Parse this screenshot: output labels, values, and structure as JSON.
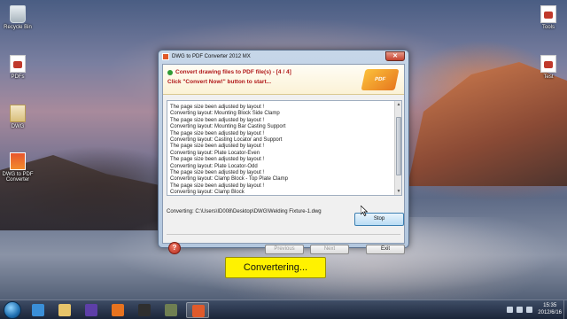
{
  "desktop": {
    "left_icons": [
      {
        "label": "Recycle Bin",
        "icon": "recycle-bin-icon"
      },
      {
        "label": "PDFs",
        "icon": "pdf-file-icon"
      },
      {
        "label": "DWG",
        "icon": "folder-icon"
      },
      {
        "label": "DWG to PDF Converter",
        "icon": "dwg-to-pdf-icon"
      }
    ],
    "right_icons": [
      {
        "label": "Tools",
        "icon": "document-icon"
      },
      {
        "label": "Test",
        "icon": "document-icon"
      }
    ]
  },
  "window": {
    "title": "DWG to PDF Converter 2012 MX",
    "close_glyph": "✕",
    "banner": {
      "line1": "Convert drawing files to PDF file(s)  - [4 / 4]",
      "line2": "Click \"Convert Now!\" button to start...",
      "art_text": "PDF"
    },
    "log": [
      "The page size been adjusted by layout !",
      "Converting layout: Mounting Block Side Clamp",
      "The page size been adjusted by layout !",
      "Converting layout: Mounting Bar Casting Support",
      "The page size been adjusted by layout !",
      "Converting layout: Casting Locator and Support",
      "The page size been adjusted by layout !",
      "Converting layout: Plate Locator-Even",
      "The page size been adjusted by layout !",
      "Converting layout: Plate Locator-Odd",
      "The page size been adjusted by layout !",
      "Converting layout: Clamp Block - Top Plate Clamp",
      "The page size been adjusted by layout !",
      "Converting layout: Clamp Block"
    ],
    "status": "Converting: C:\\Users\\ID008\\Desktop\\DWG\\Welding Fixture-1.dwg",
    "buttons": {
      "stop": "Stop",
      "previous": "Previous",
      "next": "Next",
      "exit": "Exit"
    },
    "help_glyph": "?"
  },
  "caption": "Convertering...",
  "taskbar": {
    "items": [
      {
        "name": "internet-explorer",
        "color": "#3a8fd8"
      },
      {
        "name": "windows-explorer",
        "color": "#e7c46a"
      },
      {
        "name": "media-player",
        "color": "#5d3fa8"
      },
      {
        "name": "firefox",
        "color": "#e8731f"
      },
      {
        "name": "terminal",
        "color": "#2f2f2f"
      },
      {
        "name": "photoshop",
        "color": "#6f7f52"
      },
      {
        "name": "dwg-to-pdf",
        "color": "#e05a2b"
      }
    ],
    "clock_time": "15:35",
    "clock_date": "2012/6/16"
  },
  "colors": {
    "banner_text": "#b01818",
    "caption_bg": "#fff200",
    "stop_button": "#b9dcf4"
  }
}
